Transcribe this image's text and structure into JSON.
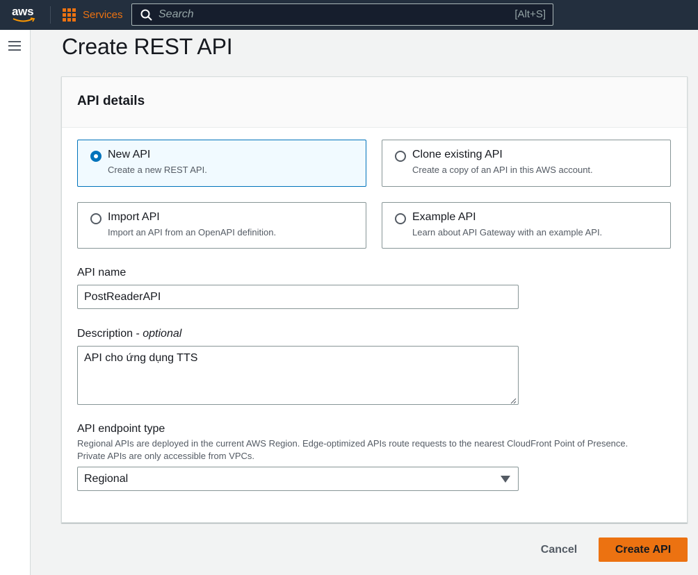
{
  "nav": {
    "logo_text": "aws",
    "services_label": "Services",
    "search_placeholder": "Search",
    "search_shortcut": "[Alt+S]",
    "accent_color": "#ec7211"
  },
  "page": {
    "title": "Create REST API"
  },
  "panel": {
    "title": "API details",
    "tiles": [
      {
        "title": "New API",
        "desc": "Create a new REST API.",
        "selected": true
      },
      {
        "title": "Clone existing API",
        "desc": "Create a copy of an API in this AWS account.",
        "selected": false
      },
      {
        "title": "Import API",
        "desc": "Import an API from an OpenAPI definition.",
        "selected": false
      },
      {
        "title": "Example API",
        "desc": "Learn about API Gateway with an example API.",
        "selected": false
      }
    ],
    "api_name": {
      "label": "API name",
      "value": "PostReaderAPI"
    },
    "description": {
      "label": "Description - ",
      "optional": "optional",
      "value": "API cho ứng dụng TTS"
    },
    "endpoint": {
      "label": "API endpoint type",
      "hint_line1": "Regional APIs are deployed in the current AWS Region. Edge-optimized APIs route requests to the nearest CloudFront Point of Presence.",
      "hint_line2": "Private APIs are only accessible from VPCs.",
      "selected": "Regional"
    }
  },
  "actions": {
    "cancel_label": "Cancel",
    "create_label": "Create API",
    "primary_color": "#ec7211"
  }
}
